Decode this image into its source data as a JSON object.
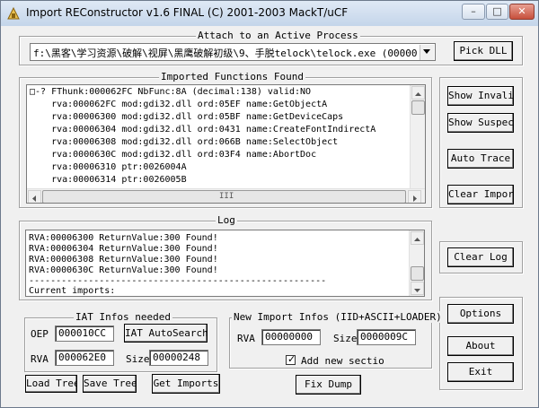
{
  "window": {
    "title": "Import REConstructor v1.6 FINAL (C) 2001-2003 MackT/uCF",
    "min_glyph": "–",
    "max_glyph": "□",
    "close_glyph": "✕"
  },
  "attach": {
    "group_label": "Attach to an Active Process",
    "process_path": "f:\\黑客\\学习资源\\破解\\视屏\\黑鹰破解初级\\9、手脱telock\\telock.exe (00000",
    "pick_dll_label": "Pick DLL"
  },
  "imported": {
    "group_label": "Imported Functions Found",
    "rows": [
      "□-? FThunk:000062FC NbFunc:8A (decimal:138) valid:NO",
      "    rva:000062FC mod:gdi32.dll ord:05EF name:GetObjectA",
      "    rva:00006300 mod:gdi32.dll ord:05BF name:GetDeviceCaps",
      "    rva:00006304 mod:gdi32.dll ord:0431 name:CreateFontIndirectA",
      "    rva:00006308 mod:gdi32.dll ord:066B name:SelectObject",
      "    rva:0000630C mod:gdi32.dll ord:03F4 name:AbortDoc",
      "    rva:00006310 ptr:0026004A",
      "    rva:00006314 ptr:0026005B"
    ],
    "hscroll_grip": "III"
  },
  "side_buttons": {
    "show_invalid": "Show Invalid",
    "show_suspect": "Show Suspect",
    "auto_trace": "Auto Trace",
    "clear_imports": "Clear Imports",
    "clear_log": "Clear Log",
    "options": "Options",
    "about": "About",
    "exit": "Exit"
  },
  "log": {
    "group_label": "Log",
    "lines": [
      "RVA:00006300 ReturnValue:300 Found!",
      "RVA:00006304 ReturnValue:300 Found!",
      "RVA:00006308 ReturnValue:300 Found!",
      "RVA:0000630C ReturnValue:300 Found!"
    ],
    "separator": "-------------------------------------------------------",
    "current_imports": "Current imports:"
  },
  "iat": {
    "group_label": "IAT Infos needed",
    "oep_label": "OEP",
    "oep_value": "000010CC",
    "autosearch_label": "IAT AutoSearch",
    "rva_label": "RVA",
    "rva_value": "000062E0",
    "size_label": "Size",
    "size_value": "00000248"
  },
  "new_import": {
    "group_label": "New Import Infos (IID+ASCII+LOADER)",
    "rva_label": "RVA",
    "rva_value": "00000000",
    "size_label": "Size",
    "size_value": "0000009C",
    "add_section_label": "Add new sectio",
    "add_section_checked": true,
    "check_glyph": "✓"
  },
  "bottom": {
    "load_tree": "Load Tree",
    "save_tree": "Save Tree",
    "get_imports": "Get Imports",
    "fix_dump": "Fix Dump"
  }
}
